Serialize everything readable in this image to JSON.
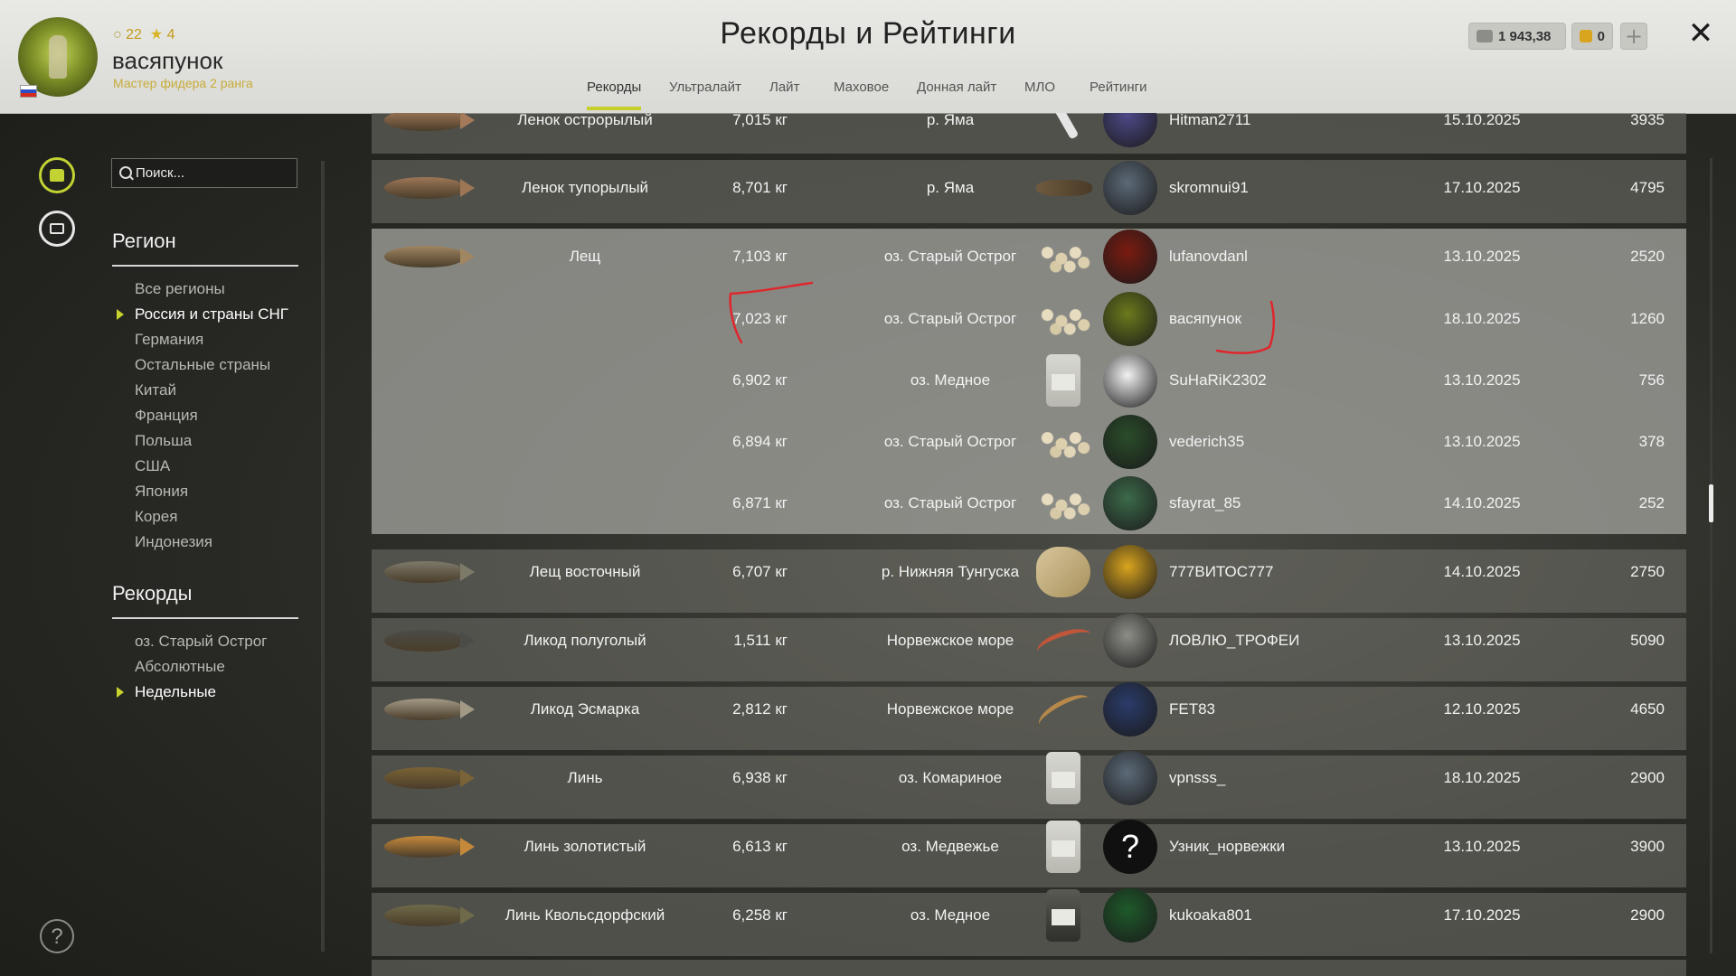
{
  "header": {
    "title": "Рекорды и Рейтинги",
    "player": {
      "name": "васяпунок",
      "rank": "Мастер фидера 2 ранга",
      "level": "22",
      "stars": "4"
    },
    "currency": {
      "silver": "1 943,38",
      "gold": "0"
    },
    "tabs": [
      {
        "label": "Рекорды",
        "active": true
      },
      {
        "label": "Ультралайт"
      },
      {
        "label": "Лайт"
      },
      {
        "label": "Маховое"
      },
      {
        "label": "Донная лайт"
      },
      {
        "label": "МЛО"
      },
      {
        "label": "Рейтинги"
      }
    ]
  },
  "sidebar": {
    "search_placeholder": "Поиск...",
    "region_title": "Регион",
    "regions": [
      {
        "label": "Все регионы"
      },
      {
        "label": "Россия и страны СНГ",
        "selected": true
      },
      {
        "label": "Германия"
      },
      {
        "label": "Остальные страны"
      },
      {
        "label": "Китай"
      },
      {
        "label": "Франция"
      },
      {
        "label": "Польша"
      },
      {
        "label": "США"
      },
      {
        "label": "Япония"
      },
      {
        "label": "Корея"
      },
      {
        "label": "Индонезия"
      }
    ],
    "records_title": "Рекорды",
    "records": [
      {
        "label": "оз. Старый Острог"
      },
      {
        "label": "Абсолютные"
      },
      {
        "label": "Недельные",
        "selected": true
      }
    ]
  },
  "rows": [
    {
      "fish": "Ленок острорылый",
      "weight": "7,015 кг",
      "location": "р. Яма",
      "bait": "lure",
      "player": "Hitman2711",
      "date": "15.10.2025",
      "points": "3935"
    },
    {
      "fish": "Ленок тупорылый",
      "weight": "8,701 кг",
      "location": "р. Яма",
      "bait": "bug",
      "player": "skromnui91",
      "date": "17.10.2025",
      "points": "4795"
    },
    {
      "fish": "Лещ",
      "weight": "7,103 кг",
      "location": "оз. Старый Острог",
      "bait": "pellets",
      "player": "lufanovdanl",
      "date": "13.10.2025",
      "points": "2520"
    },
    {
      "fish": "",
      "weight": "7,023 кг",
      "location": "оз. Старый Острог",
      "bait": "pellets",
      "player": "васяпунок",
      "date": "18.10.2025",
      "points": "1260"
    },
    {
      "fish": "",
      "weight": "6,902 кг",
      "location": "оз. Медное",
      "bait": "jar",
      "player": "SuHaRiK2302",
      "date": "13.10.2025",
      "points": "756"
    },
    {
      "fish": "",
      "weight": "6,894 кг",
      "location": "оз. Старый Острог",
      "bait": "pellets",
      "player": "vederich35",
      "date": "13.10.2025",
      "points": "378"
    },
    {
      "fish": "",
      "weight": "6,871 кг",
      "location": "оз. Старый Острог",
      "bait": "pellets",
      "player": "sfayrat_85",
      "date": "14.10.2025",
      "points": "252"
    },
    {
      "fish": "Лещ восточный",
      "weight": "6,707 кг",
      "location": "р. Нижняя Тунгуска",
      "bait": "shrimp",
      "player": "777ВИТОС777",
      "date": "14.10.2025",
      "points": "2750"
    },
    {
      "fish": "Ликод полуголый",
      "weight": "1,511 кг",
      "location": "Норвежское море",
      "bait": "worm",
      "player": "ЛОВЛЮ_ТРОФЕИ",
      "date": "13.10.2025",
      "points": "5090"
    },
    {
      "fish": "Ликод Эсмарка",
      "weight": "2,812 кг",
      "location": "Норвежское море",
      "bait": "worm",
      "player": "FET83",
      "date": "12.10.2025",
      "points": "4650"
    },
    {
      "fish": "Линь",
      "weight": "6,938 кг",
      "location": "оз. Комариное",
      "bait": "jar",
      "player": "vpnsss_",
      "date": "18.10.2025",
      "points": "2900"
    },
    {
      "fish": "Линь золотистый",
      "weight": "6,613 кг",
      "location": "оз. Медвежье",
      "bait": "jar",
      "player": "Узник_норвежки",
      "date": "13.10.2025",
      "points": "3900"
    },
    {
      "fish": "Линь Квольсдорфский",
      "weight": "6,258 кг",
      "location": "оз. Медное",
      "bait": "jar",
      "player": "kukoaka801",
      "date": "17.10.2025",
      "points": "2900"
    }
  ],
  "avatar_placeholder": "?",
  "help_icon_glyph": "?",
  "close_glyph": "✕",
  "plus_glyph": "+",
  "colors": {
    "accent": "#c7d22c",
    "header_bg": "#e2e2de",
    "row_bg": "#6e6e68",
    "row_expanded_bg": "#9b9b96",
    "annotation": "#e0262c"
  }
}
